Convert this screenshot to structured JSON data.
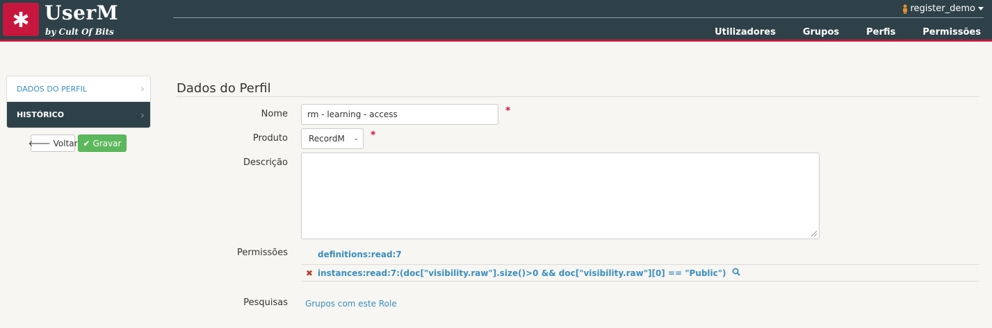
{
  "brand": {
    "title": "UserM",
    "subtitle": "by Cult Of Bits",
    "accent_color": "#c8173f",
    "header_color": "#2e4148"
  },
  "user_menu": {
    "username": "register_demo",
    "icon": "person-icon"
  },
  "nav": {
    "items": [
      {
        "label": "Utilizadores"
      },
      {
        "label": "Grupos"
      },
      {
        "label": "Perfis"
      },
      {
        "label": "Permissões"
      }
    ]
  },
  "sidebar": {
    "items": [
      {
        "label": "DADOS DO PERFIL",
        "active": false
      },
      {
        "label": "HISTÓRICO",
        "active": true
      }
    ],
    "back_label": "Voltar",
    "save_label": "Gravar",
    "save_color": "#5cb85c"
  },
  "form": {
    "title": "Dados do Perfil",
    "name_label": "Nome",
    "name_value": "rm - learning - access",
    "required_mark": "*",
    "product_label": "Produto",
    "product_value": "RecordM",
    "description_label": "Descrição",
    "description_value": "",
    "permissions_label": "Permissões",
    "permissions": [
      {
        "text": "definitions:read:7",
        "removable": false
      },
      {
        "text": "instances:read:7:(doc[\"visibility.raw\"].size()>0 && doc[\"visibility.raw\"][0] == \"Public\")",
        "removable": true
      }
    ],
    "searches_label": "Pesquisas",
    "searches_link": "Grupos com este Role"
  }
}
